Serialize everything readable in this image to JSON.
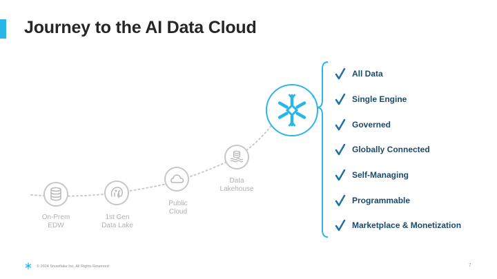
{
  "slide": {
    "title": "Journey to the AI Data Cloud",
    "accent_color": "#29B5E8",
    "footer": "© 2024 Snowflake Inc. All Rights Reserved",
    "page_number": "7"
  },
  "journey": [
    {
      "label": "On-Prem\nEDW",
      "icon": "database-icon"
    },
    {
      "label": "1st Gen\nData Lake",
      "icon": "elephant-icon"
    },
    {
      "label": "Public\nCloud",
      "icon": "cloud-icon"
    },
    {
      "label": "Data\nLakehouse",
      "icon": "lakehouse-icon"
    }
  ],
  "destination": {
    "icon": "snowflake-logo-icon",
    "registered": "®"
  },
  "features": [
    {
      "label": "All Data"
    },
    {
      "label": "Single Engine"
    },
    {
      "label": "Governed"
    },
    {
      "label": "Globally Connected"
    },
    {
      "label": "Self-Managing"
    },
    {
      "label": "Programmable"
    },
    {
      "label": "Marketplace & Monetization"
    }
  ]
}
